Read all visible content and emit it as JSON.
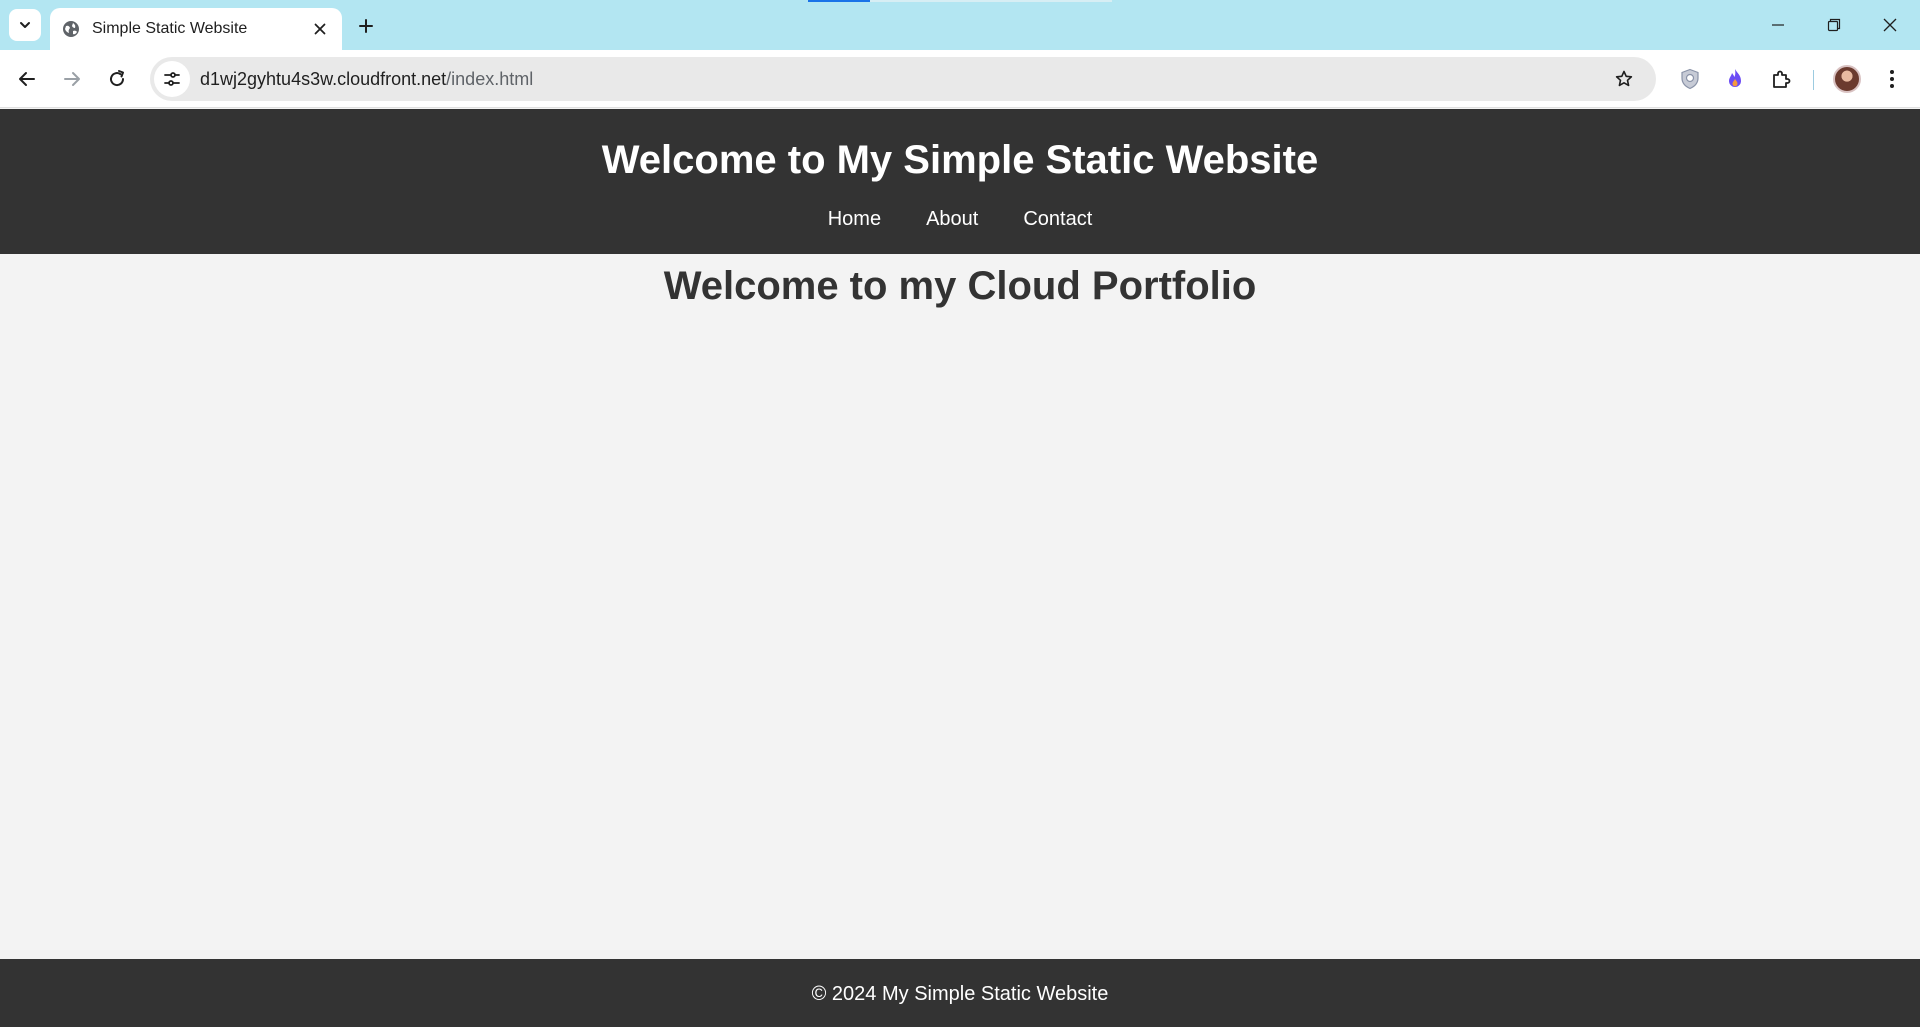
{
  "browser": {
    "tab": {
      "title": "Simple Static Website",
      "icon": "globe-icon"
    },
    "address": {
      "host": "d1wj2gyhtu4s3w.cloudfront.net",
      "path": "/index.html"
    },
    "colors": {
      "tabstrip": "#b3e6f2",
      "toolbar": "#ffffff",
      "omnibox": "#e9e9e9"
    }
  },
  "page": {
    "header": {
      "title": "Welcome to My Simple Static Website",
      "nav": [
        {
          "label": "Home"
        },
        {
          "label": "About"
        },
        {
          "label": "Contact"
        }
      ]
    },
    "main": {
      "heading": "Welcome to my Cloud Portfolio"
    },
    "footer": {
      "text": "© 2024 My Simple Static Website"
    },
    "colors": {
      "header_bg": "#333333",
      "body_bg": "#f3f3f3",
      "text": "#333333"
    }
  }
}
